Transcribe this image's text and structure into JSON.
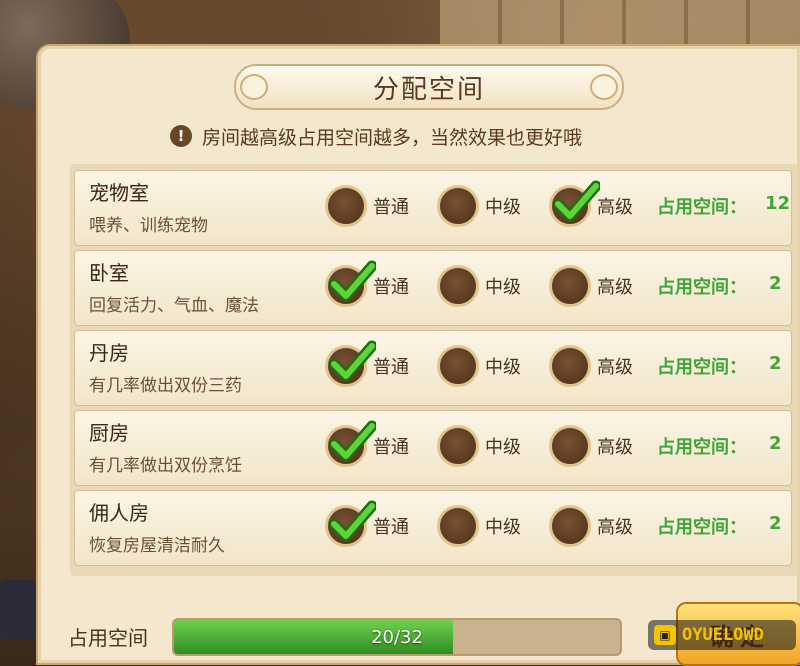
{
  "dialog": {
    "title": "分配空间",
    "notice_icon": "!",
    "notice": "房间越高级占用空间越多，当然效果也更好哦"
  },
  "levels": [
    "普通",
    "中级",
    "高级"
  ],
  "space_label": "占用空间：",
  "rooms": [
    {
      "name": "宠物室",
      "desc": "喂养、训练宠物",
      "selected_level": "高级",
      "space": "12"
    },
    {
      "name": "卧室",
      "desc": "回复活力、气血、魔法",
      "selected_level": "普通",
      "space": "2"
    },
    {
      "name": "丹房",
      "desc": "有几率做出双份三药",
      "selected_level": "普通",
      "space": "2"
    },
    {
      "name": "厨房",
      "desc": "有几率做出双份烹饪",
      "selected_level": "普通",
      "space": "2"
    },
    {
      "name": "佣人房",
      "desc": "恢复房屋清洁耐久",
      "selected_level": "普通",
      "space": "2"
    }
  ],
  "footer": {
    "usage_label": "占用空间",
    "usage_text": "20/32",
    "usage_used": 20,
    "usage_total": 32,
    "confirm_label": "确定"
  },
  "watermark": {
    "icon": "game",
    "text": "OYUELOWD"
  },
  "colors": {
    "panel": "#f3e7cd",
    "green_text": "#3fa535",
    "progress_green": "#4cb534",
    "button_gold": "#f0a628"
  }
}
